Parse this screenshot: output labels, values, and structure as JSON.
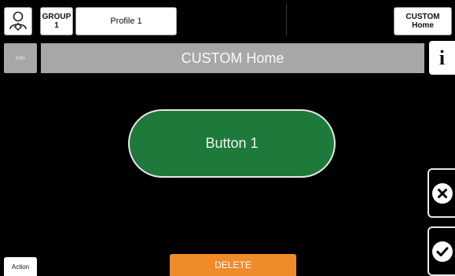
{
  "header": {
    "group_line1": "GROUP",
    "group_line2": "1",
    "profile": "Profile 1",
    "custom_line1": "CUSTOM",
    "custom_line2": "Home"
  },
  "title": {
    "info_tab": "Info",
    "text": "CUSTOM Home",
    "info_button": "i"
  },
  "main": {
    "button_label": "Button 1",
    "button_color": "#1e7a3b"
  },
  "footer": {
    "action_tab": "Action",
    "delete_label": "DELETE",
    "delete_color": "#ef8b2a"
  },
  "icons": {
    "user_settings": "user-gear-icon",
    "cancel": "close-icon",
    "confirm": "check-icon"
  }
}
